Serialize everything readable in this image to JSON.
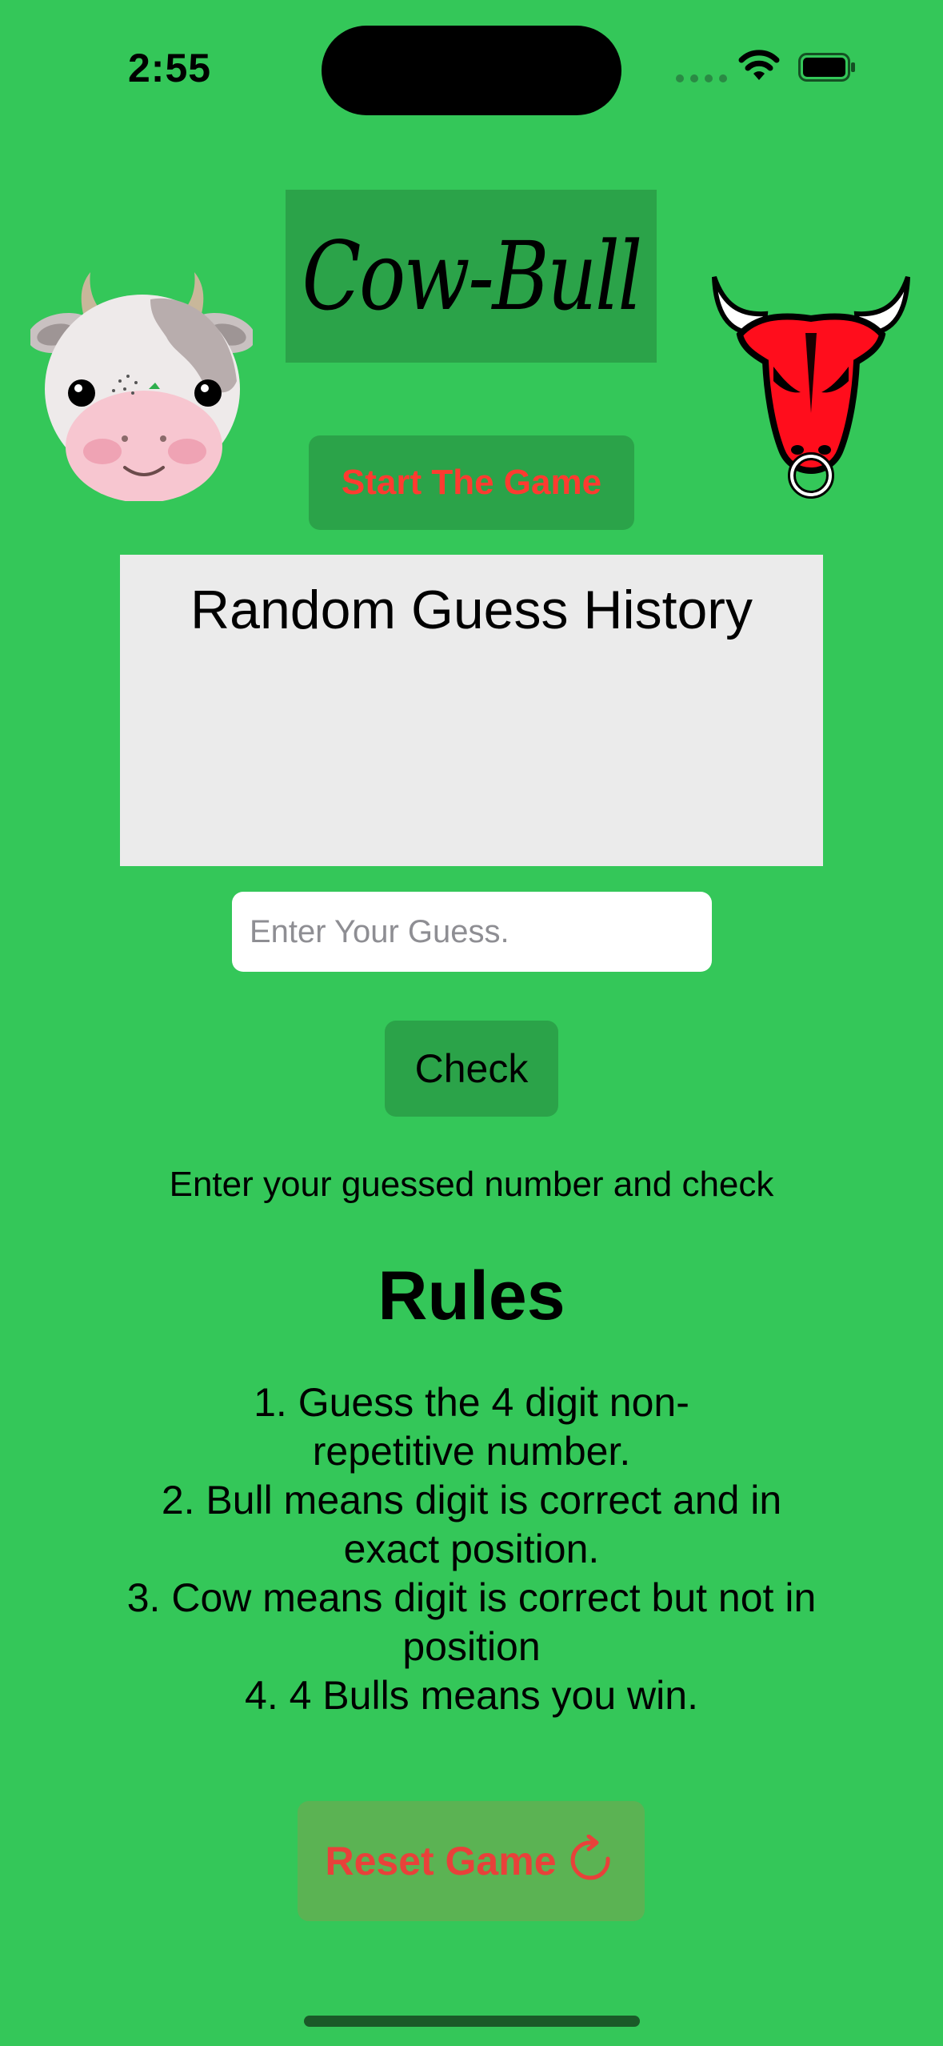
{
  "status_bar": {
    "time": "2:55"
  },
  "app": {
    "title": "Cow-Bull",
    "start_button": "Start The Game",
    "history_title": "Random Guess History",
    "guess_input": {
      "placeholder": "Enter Your Guess.",
      "value": ""
    },
    "check_button": "Check",
    "instruction": "Enter your guessed number and check",
    "rules_title": "Rules",
    "rules": [
      "1. Guess the 4 digit non-repetitive number.",
      "2. Bull means digit is correct and in exact position.",
      "3. Cow means digit is correct but not in position",
      "4. 4 Bulls means you win."
    ],
    "reset_button": "Reset Game"
  },
  "icons": {
    "cow": "cow-face-icon",
    "bull": "bull-head-icon",
    "reset": "arrow-clockwise-icon",
    "wifi": "wifi-icon",
    "battery": "battery-icon",
    "cellular": "cellular-signal-icon"
  },
  "colors": {
    "background": "#34C759",
    "button": "#2BA349",
    "accent_red": "#FF3B30",
    "history_bg": "#EBEBEB",
    "reset_bg": "#5BB353"
  }
}
